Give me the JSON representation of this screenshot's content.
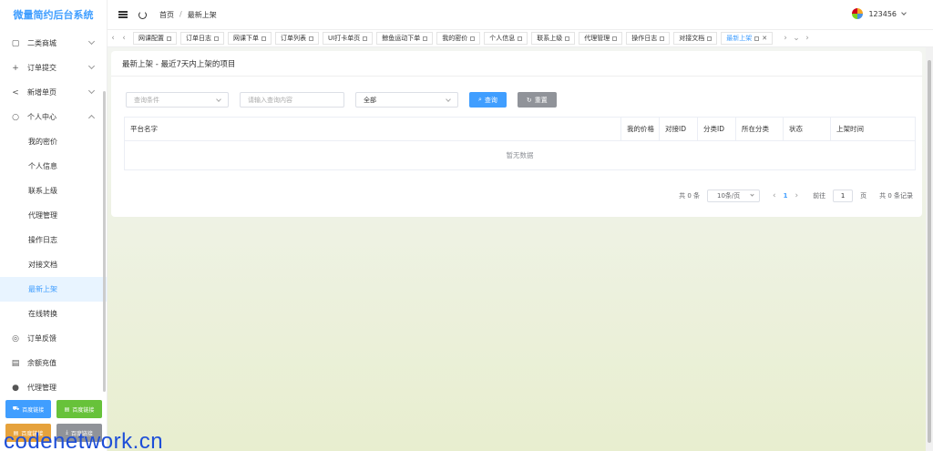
{
  "app": {
    "title": "微量简约后台系统"
  },
  "sidebar": {
    "items": [
      {
        "label": "二类商城",
        "icon": "bag-icon",
        "expandable": true
      },
      {
        "label": "订单提交",
        "icon": "plus-icon",
        "expandable": true
      },
      {
        "label": "新增单页",
        "icon": "share-icon",
        "expandable": true
      },
      {
        "label": "个人中心",
        "icon": "user-icon",
        "expandable": true,
        "expanded": true
      }
    ],
    "sub_items": [
      "我的密价",
      "个人信息",
      "联系上级",
      "代理管理",
      "操作日志",
      "对接文档",
      "最新上架",
      "在线转换"
    ],
    "active_sub": "最新上架",
    "bottom_items": [
      {
        "label": "订单反馈",
        "icon": "feedback-icon"
      },
      {
        "label": "余额充值",
        "icon": "wallet-icon"
      },
      {
        "label": "代理管理",
        "icon": "person-icon"
      }
    ],
    "buttons": [
      {
        "label": "百度链接",
        "color": "#409eff",
        "icon": "cart-icon"
      },
      {
        "label": "百度链接",
        "color": "#67c23a",
        "icon": "doc-icon"
      },
      {
        "label": "百度链接",
        "color": "#e6a23c",
        "icon": "doc-icon"
      },
      {
        "label": "百度链接",
        "color": "#909399",
        "icon": "download-icon"
      }
    ]
  },
  "header": {
    "breadcrumb": [
      "首页",
      "最新上架"
    ],
    "breadcrumb_sep": "/",
    "username": "123456"
  },
  "tabs": [
    "网课配置",
    "订单日志",
    "网课下单",
    "订单列表",
    "UI打卡单页",
    "鲸鱼运动下单",
    "我的密价",
    "个人信息",
    "联系上级",
    "代理管理",
    "操作日志",
    "对接文档",
    "最新上架"
  ],
  "active_tab": "最新上架",
  "card": {
    "title": "最新上架 - 最近7天内上架的项目",
    "filters": {
      "condition_placeholder": "查询条件",
      "keyword_placeholder": "请输入查询内容",
      "category_value": "全部",
      "search_label": "查询",
      "reset_label": "重置"
    },
    "table": {
      "columns": [
        "平台名字",
        "我的价格",
        "对接ID",
        "分类ID",
        "所在分类",
        "状态",
        "上架时间"
      ],
      "empty_text": "暂无数据"
    },
    "pager": {
      "total_label": "共 0 条",
      "page_size": "10条/页",
      "current_page": "1",
      "goto_label": "前往",
      "goto_value": "1",
      "page_unit": "页",
      "records_label": "共 0 条记录"
    }
  },
  "watermark": "codenetwork.cn",
  "colors": {
    "primary": "#409eff",
    "success": "#67c23a",
    "warning": "#e6a23c",
    "info": "#909399"
  }
}
